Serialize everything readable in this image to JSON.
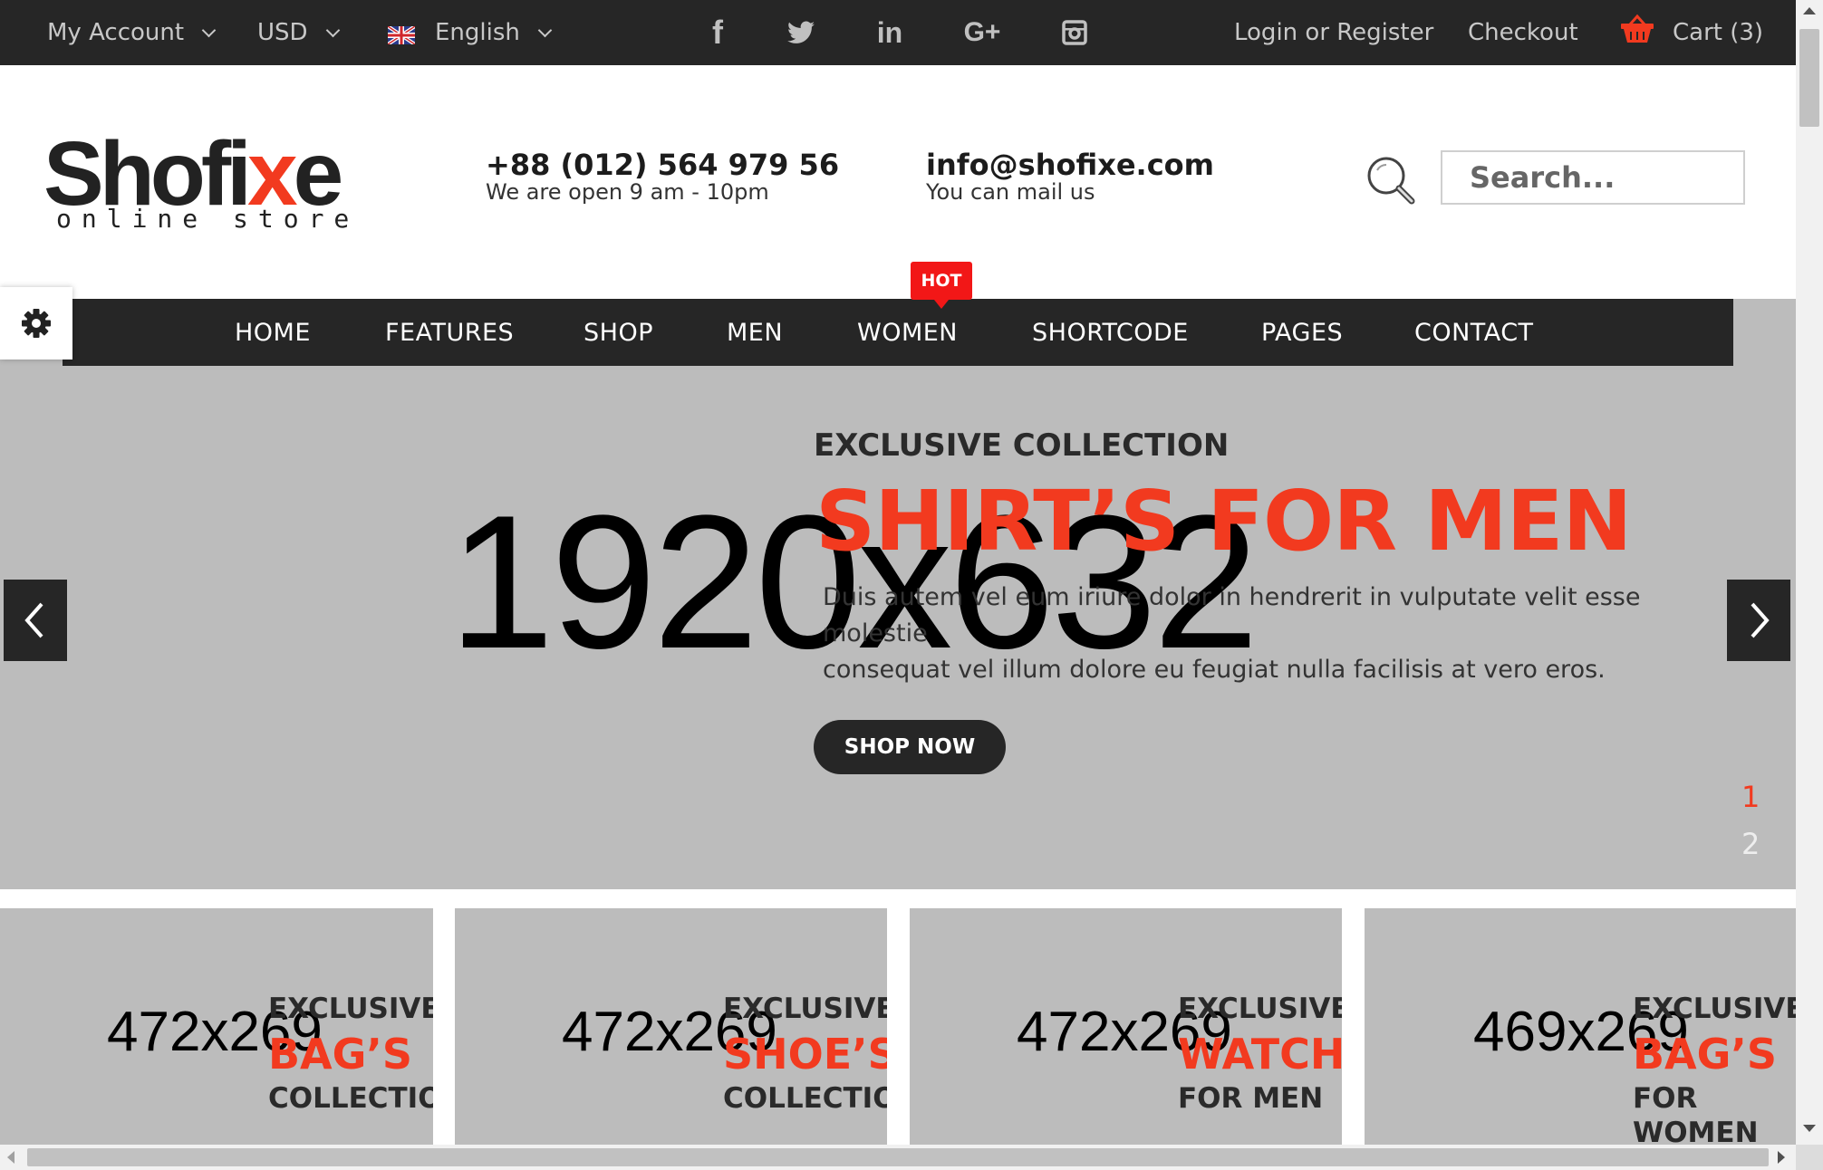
{
  "topbar": {
    "account_label": "My Account",
    "currency_label": "USD",
    "language_label": "English",
    "social_icons": [
      "facebook-icon",
      "twitter-icon",
      "linkedin-icon",
      "google-plus-icon",
      "instagram-icon"
    ],
    "login_label": "Login or Register",
    "checkout_label": "Checkout",
    "cart_label": "Cart (3)"
  },
  "header": {
    "logo_text_a": "Shofi",
    "logo_text_x": "x",
    "logo_text_b": "e",
    "logo_tagline": "online store",
    "phone": "+88 (012) 564 979 56",
    "hours": "We are open 9 am - 10pm",
    "email": "info@shofixe.com",
    "email_note": "You can mail us",
    "search_placeholder": "Search..."
  },
  "nav": {
    "items": [
      "HOME",
      "FEATURES",
      "SHOP",
      "MEN",
      "WOMEN",
      "SHORTCODE",
      "PAGES",
      "CONTACT"
    ],
    "hot_badge": "HOT"
  },
  "slider": {
    "placeholder": "1920x632",
    "kicker": "EXCLUSIVE COLLECTION",
    "title": "SHIRT’S FOR MEN",
    "text_line1": "Duis autem vel eum iriure dolor in hendrerit in vulputate velit esse molestie",
    "text_line2": "consequat vel illum dolore eu feugiat nulla facilisis at vero eros.",
    "button_label": "SHOP NOW",
    "pagination": [
      "1",
      "2"
    ],
    "active_page": "1"
  },
  "banners": [
    {
      "placeholder": "472x269",
      "line1": "EXCLUSIVE",
      "line2": "BAG’S",
      "line3": "COLLECTION",
      "line4": ""
    },
    {
      "placeholder": "472x269",
      "line1": "EXCLUSIVE",
      "line2": "SHOE’S",
      "line3": "COLLECTION",
      "line4": ""
    },
    {
      "placeholder": "472x269",
      "line1": "EXCLUSIVE",
      "line2": "WATCH",
      "line3": "FOR MEN",
      "line4": ""
    },
    {
      "placeholder": "469x269",
      "line1": "EXCLUSIVE",
      "line2": "BAG’S",
      "line3": "FOR",
      "line4": "WOMEN"
    }
  ],
  "colors": {
    "accent": "#f23a1f",
    "dark": "#262626",
    "placeholder_bg": "#bcbcbc",
    "hot_badge": "#f21717"
  }
}
